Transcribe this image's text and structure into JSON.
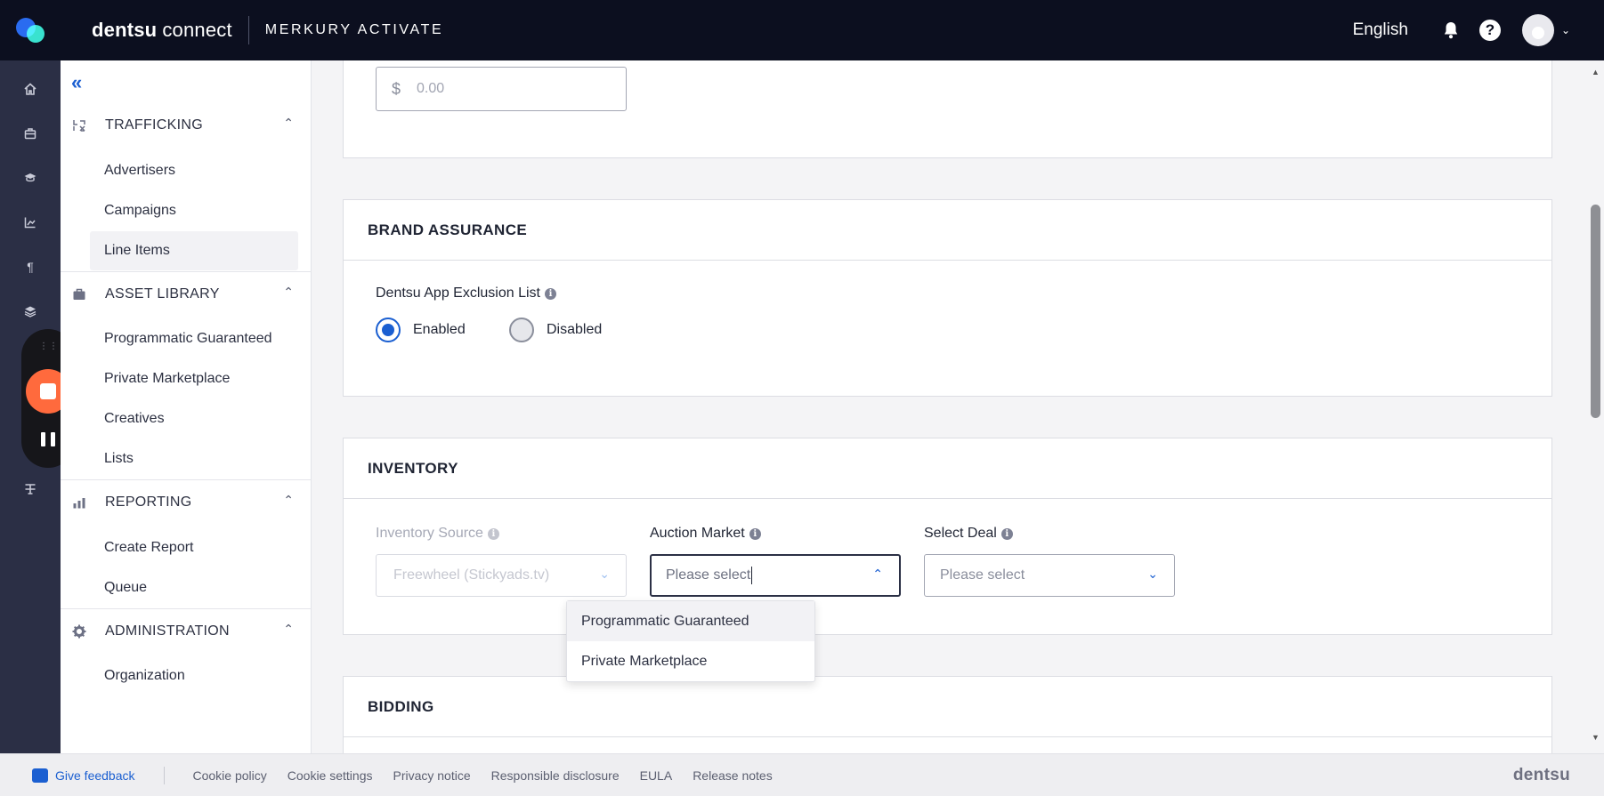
{
  "header": {
    "brand_bold": "dentsu",
    "brand_light": "connect",
    "product": "MERKURY ACTIVATE",
    "language": "English",
    "help_glyph": "?"
  },
  "sidebar": {
    "sections": [
      {
        "title": "TRAFFICKING",
        "items": [
          "Advertisers",
          "Campaigns",
          "Line Items"
        ]
      },
      {
        "title": "ASSET LIBRARY",
        "items": [
          "Programmatic Guaranteed",
          "Private Marketplace",
          "Creatives",
          "Lists"
        ]
      },
      {
        "title": "REPORTING",
        "items": [
          "Create Report",
          "Queue"
        ]
      },
      {
        "title": "ADMINISTRATION",
        "items": [
          "Organization"
        ]
      }
    ],
    "active_item": "Line Items"
  },
  "budget": {
    "currency": "$",
    "placeholder": "0.00"
  },
  "brand_assurance": {
    "title": "BRAND ASSURANCE",
    "field_label": "Dentsu App Exclusion List",
    "options": [
      "Enabled",
      "Disabled"
    ],
    "selected": "Enabled"
  },
  "inventory": {
    "title": "INVENTORY",
    "source_label": "Inventory Source",
    "source_value": "Freewheel (Stickyads.tv)",
    "auction_label": "Auction Market",
    "auction_value": "Please select",
    "auction_options": [
      "Programmatic Guaranteed",
      "Private Marketplace"
    ],
    "deal_label": "Select Deal",
    "deal_value": "Please select"
  },
  "bidding": {
    "title": "BIDDING"
  },
  "footer": {
    "feedback": "Give feedback",
    "links": [
      "Cookie policy",
      "Cookie settings",
      "Privacy notice",
      "Responsible disclosure",
      "EULA",
      "Release notes"
    ],
    "brand": "dentsu"
  },
  "colors": {
    "topbar": "#0c0f1f",
    "accent": "#1b5fd1",
    "rail": "#2b2f45",
    "record": "#ff6a3d"
  }
}
